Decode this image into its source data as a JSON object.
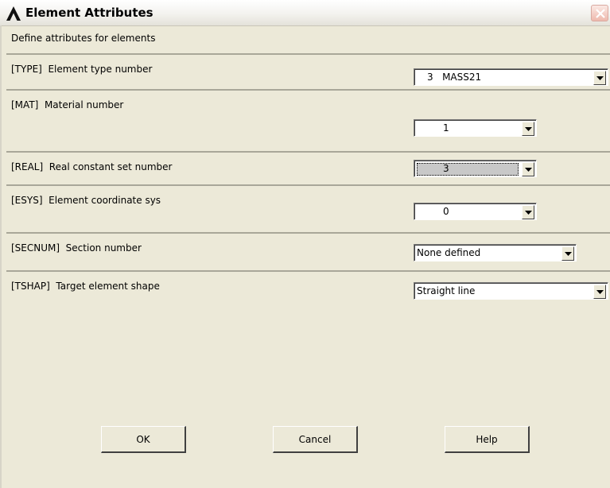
{
  "window": {
    "title": "Element Attributes",
    "icons": {
      "app": "ansys-logo-icon",
      "close": "close-icon"
    },
    "accent_color": "#d9776a"
  },
  "header": {
    "text": "Define attributes for elements"
  },
  "fields": [
    {
      "label": "[TYPE]  Element type number",
      "value": "3   MASS21"
    },
    {
      "label": "[MAT]  Material number",
      "value": "1"
    },
    {
      "label": "[REAL]  Real constant set number",
      "value": "3"
    },
    {
      "label": "[ESYS]  Element coordinate sys",
      "value": "0"
    },
    {
      "label": "[SECNUM]  Section number",
      "value": "None defined"
    },
    {
      "label": "[TSHAP]  Target element shape",
      "value": "Straight line"
    }
  ],
  "buttons": {
    "ok": "OK",
    "cancel": "Cancel",
    "help": "Help"
  }
}
